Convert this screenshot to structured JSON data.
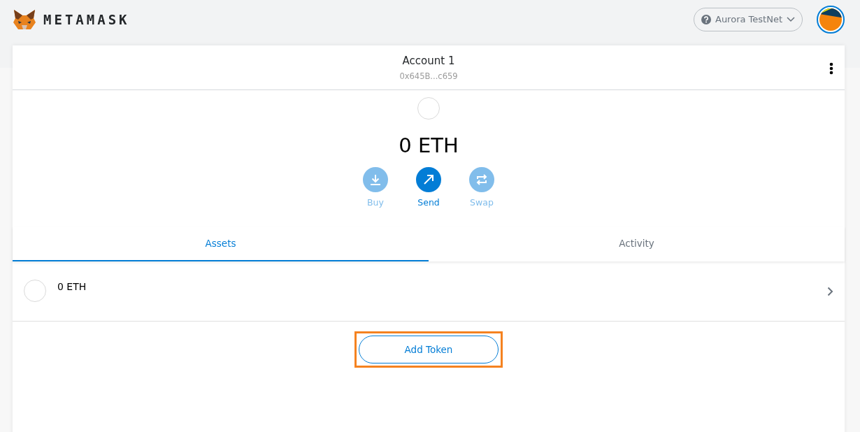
{
  "header": {
    "logo_text": "METAMASK",
    "network": {
      "label": "Aurora TestNet"
    }
  },
  "account": {
    "name": "Account 1",
    "address": "0x645B...c659"
  },
  "balance": "0 ETH",
  "actions": [
    {
      "kind": "buy",
      "label": "Buy",
      "disabled": true
    },
    {
      "kind": "send",
      "label": "Send",
      "disabled": false
    },
    {
      "kind": "swap",
      "label": "Swap",
      "disabled": true
    }
  ],
  "tabs": [
    {
      "label": "Assets",
      "selected": true
    },
    {
      "label": "Activity",
      "selected": false
    }
  ],
  "assets": [
    {
      "amount": "0 ETH"
    }
  ],
  "add_token": {
    "label": "Add Token",
    "highlighted": true
  }
}
